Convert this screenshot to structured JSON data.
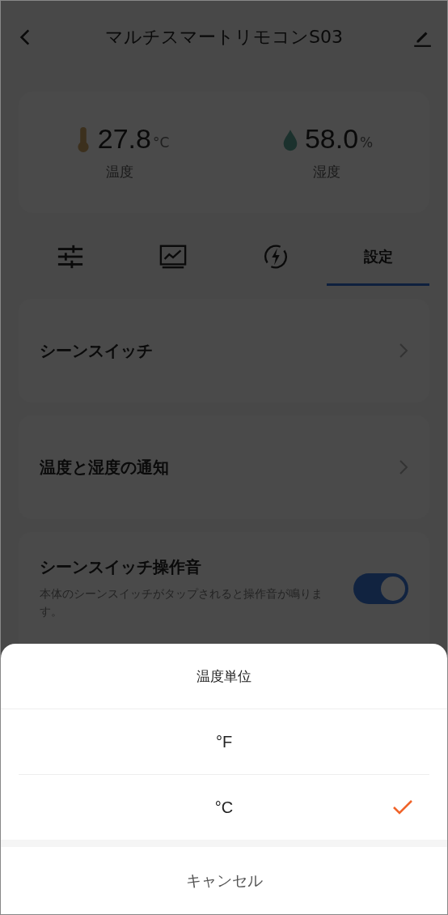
{
  "header": {
    "title": "マルチスマートリモコンS03"
  },
  "sensors": [
    {
      "kind": "temperature",
      "value": "27.8",
      "unit": "°C",
      "label": "温度"
    },
    {
      "kind": "humidity",
      "value": "58.0",
      "unit": "%",
      "label": "湿度"
    }
  ],
  "tabs": [
    {
      "kind": "controls",
      "selected": false
    },
    {
      "kind": "chart",
      "selected": false
    },
    {
      "kind": "energy",
      "selected": false
    },
    {
      "kind": "text",
      "label": "設定",
      "selected": true
    }
  ],
  "settings": [
    {
      "kind": "link",
      "title": "シーンスイッチ"
    },
    {
      "kind": "link",
      "title": "温度と湿度の通知"
    },
    {
      "kind": "toggle",
      "title": "シーンスイッチ操作音",
      "description": "本体のシーンスイッチがタップされると操作音が鳴ります。",
      "on": true
    }
  ],
  "sheet": {
    "title": "温度単位",
    "options": [
      {
        "label": "°F",
        "selected": false
      },
      {
        "label": "°C",
        "selected": true
      }
    ],
    "cancel": "キャンセル"
  }
}
